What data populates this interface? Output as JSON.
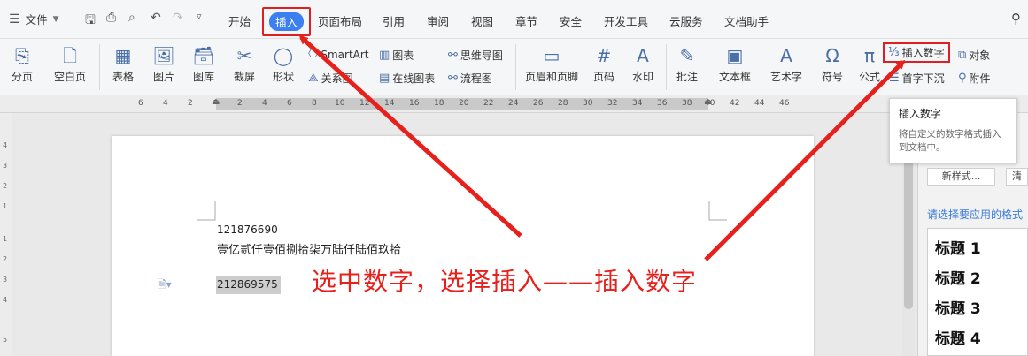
{
  "menubar": {
    "file_label": "文件",
    "tabs": [
      {
        "label": "开始"
      },
      {
        "label": "插入"
      },
      {
        "label": "页面布局"
      },
      {
        "label": "引用"
      },
      {
        "label": "审阅"
      },
      {
        "label": "视图"
      },
      {
        "label": "章节"
      },
      {
        "label": "安全"
      },
      {
        "label": "开发工具"
      },
      {
        "label": "云服务"
      },
      {
        "label": "文档助手"
      }
    ],
    "active_tab": "插入"
  },
  "ribbon": {
    "page_break": "分页",
    "blank_page": "空白页",
    "table": "表格",
    "picture": "图片",
    "gallery": "图库",
    "screenshot": "截屏",
    "shapes": "形状",
    "smartart": "SmartArt",
    "relation": "关系图",
    "chart": "图表",
    "online_chart": "在线图表",
    "mindmap": "思维导图",
    "flowchart": "流程图",
    "header_footer": "页眉和页脚",
    "page_number": "页码",
    "watermark": "水印",
    "comment": "批注",
    "textbox": "文本框",
    "wordart": "艺术字",
    "symbol": "符号",
    "formula": "公式",
    "insert_number": "插入数字",
    "object": "对象",
    "dropcap": "首字下沉",
    "attachment": "附件"
  },
  "ruler": {
    "ticks": [
      "6",
      "4",
      "2",
      "2",
      "4",
      "6",
      "8",
      "10",
      "12",
      "14",
      "16",
      "18",
      "20",
      "22",
      "24",
      "26",
      "28",
      "30",
      "32",
      "34",
      "36",
      "38",
      "40",
      "42",
      "44",
      "46"
    ],
    "vticks": [
      "4",
      "3",
      "2",
      "1",
      "1",
      "2",
      "3",
      "4",
      "5"
    ]
  },
  "document": {
    "line1": "121876690",
    "line2": "壹亿贰仟壹佰捌拾柒万陆仟陆佰玖拾",
    "selected": "212869575"
  },
  "annotation": "选中数字，选择插入——插入数字",
  "tooltip": {
    "title": "插入数字",
    "desc": "将自定义的数字格式插入到文档中。"
  },
  "panel": {
    "new_style": "新样式...",
    "clear": "清",
    "prompt": "请选择要应用的格式",
    "styles": [
      "标题 1",
      "标题 2",
      "标题 3",
      "标题 4"
    ]
  },
  "colors": {
    "accent": "#3c7ff0",
    "highlight": "#e02020",
    "annotation": "#e8201c"
  }
}
